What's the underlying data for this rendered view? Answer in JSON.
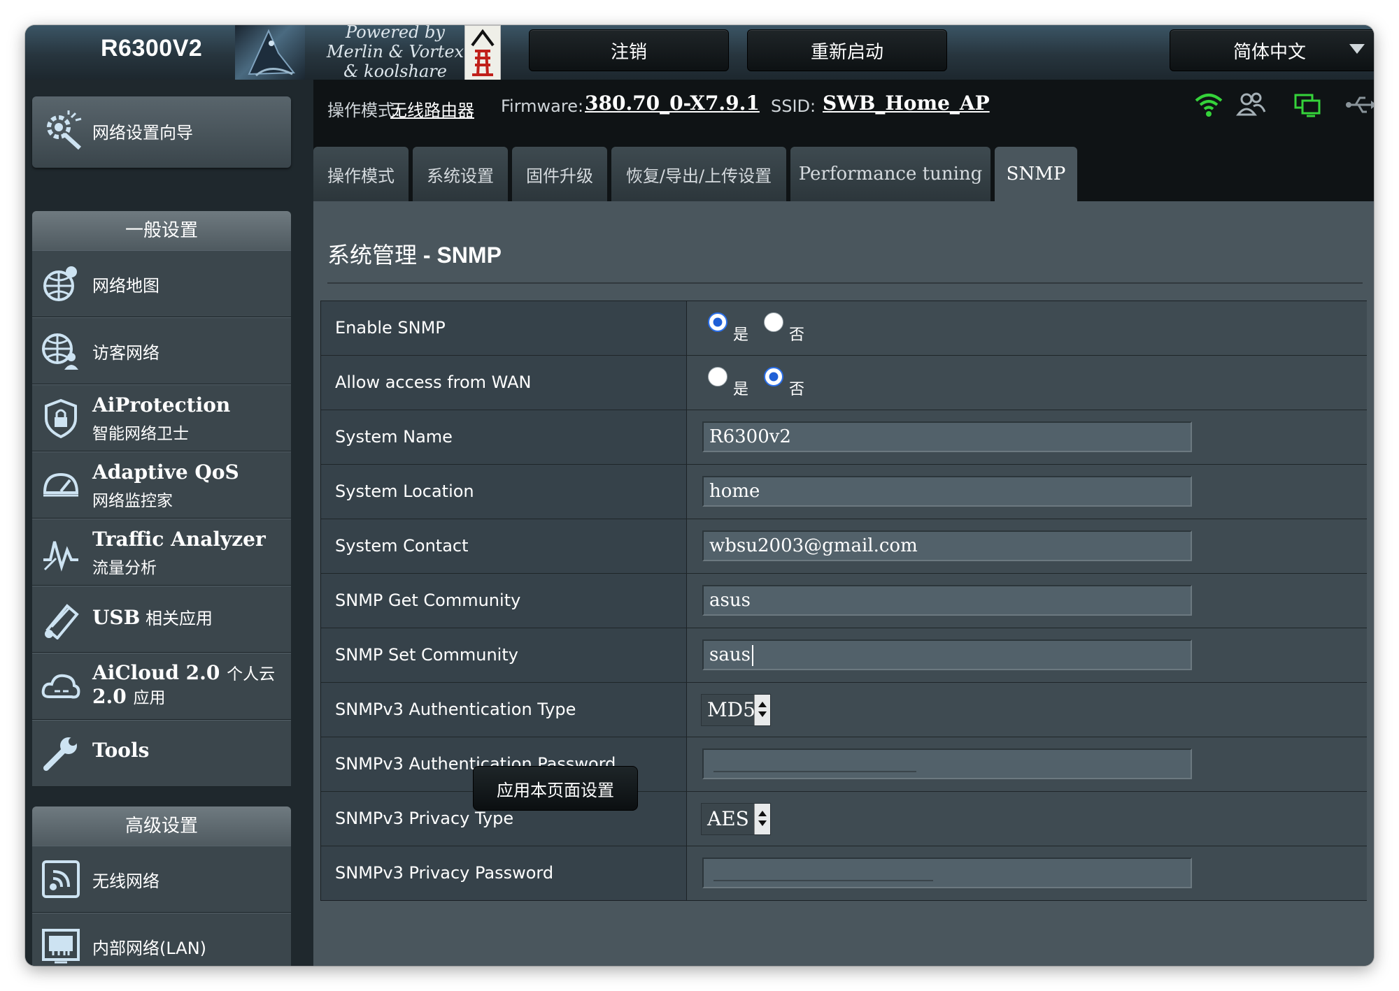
{
  "banner": {
    "model": "R6300V2",
    "powered_by": [
      "Powered by",
      "Merlin & Vortex",
      "& koolshare"
    ],
    "logout_label": "注销",
    "reboot_label": "重新启动",
    "language": "简体中文"
  },
  "status": {
    "mode_label": "操作模式:",
    "mode_value": "无线路由器",
    "firmware_label": "Firmware:",
    "firmware_value": "380.70_0-X7.9.1",
    "ssid_label": "SSID:",
    "ssid_value": "SWB_Home_AP",
    "icons": [
      "wifi-icon",
      "clients-icon",
      "network-icon",
      "usb-icon"
    ],
    "wifi_color": "#35d33a",
    "network_color": "#35d33a"
  },
  "sidebar": {
    "wizard_label": "网络设置向导",
    "general_header": "一般设置",
    "general_items": [
      {
        "title": "网络地图",
        "subtitle": ""
      },
      {
        "title": "访客网络",
        "subtitle": ""
      },
      {
        "title": "AiProtection",
        "subtitle": "智能网络卫士"
      },
      {
        "title": "Adaptive QoS",
        "subtitle": "网络监控家"
      },
      {
        "title": "Traffic Analyzer",
        "subtitle": "流量分析"
      },
      {
        "title": "USB",
        "title_suffix": "相关应用",
        "subtitle": ""
      },
      {
        "title": "AiCloud 2.0",
        "title_suffix": "个人云",
        "subtitle_bold": "2.0",
        "subtitle": "应用"
      },
      {
        "title": "Tools",
        "subtitle": ""
      }
    ],
    "advanced_header": "高级设置",
    "advanced_items": [
      {
        "title": "无线网络"
      },
      {
        "title": "内部网络(LAN)"
      }
    ]
  },
  "tabs": [
    {
      "label": "操作模式",
      "active": false
    },
    {
      "label": "系统设置",
      "active": false
    },
    {
      "label": "固件升级",
      "active": false
    },
    {
      "label": "恢复/导出/上传设置",
      "active": false
    },
    {
      "label": "Performance tuning",
      "active": false
    },
    {
      "label": "SNMP",
      "active": true
    }
  ],
  "page": {
    "title_prefix": "系统管理",
    "title_sep": " - ",
    "title_suffix": "SNMP"
  },
  "form": {
    "enable_snmp": {
      "label": "Enable SNMP",
      "yes": "是",
      "no": "否",
      "value": "yes"
    },
    "allow_wan": {
      "label": "Allow access from WAN",
      "yes": "是",
      "no": "否",
      "value": "no"
    },
    "system_name": {
      "label": "System Name",
      "value": "R6300v2"
    },
    "system_location": {
      "label": "System Location",
      "value": "home"
    },
    "system_contact": {
      "label": "System Contact",
      "value": "wbsu2003@gmail.com"
    },
    "get_community": {
      "label": "SNMP Get Community",
      "value": "asus"
    },
    "set_community": {
      "label": "SNMP Set Community",
      "value": "saus"
    },
    "auth_type": {
      "label": "SNMPv3 Authentication Type",
      "value": "MD5"
    },
    "auth_password": {
      "label": "SNMPv3 Authentication Password",
      "value": ""
    },
    "privacy_type": {
      "label": "SNMPv3 Privacy Type",
      "value": "AES"
    },
    "privacy_password": {
      "label": "SNMPv3 Privacy Password",
      "value": ""
    }
  },
  "apply_label": "应用本页面设置"
}
